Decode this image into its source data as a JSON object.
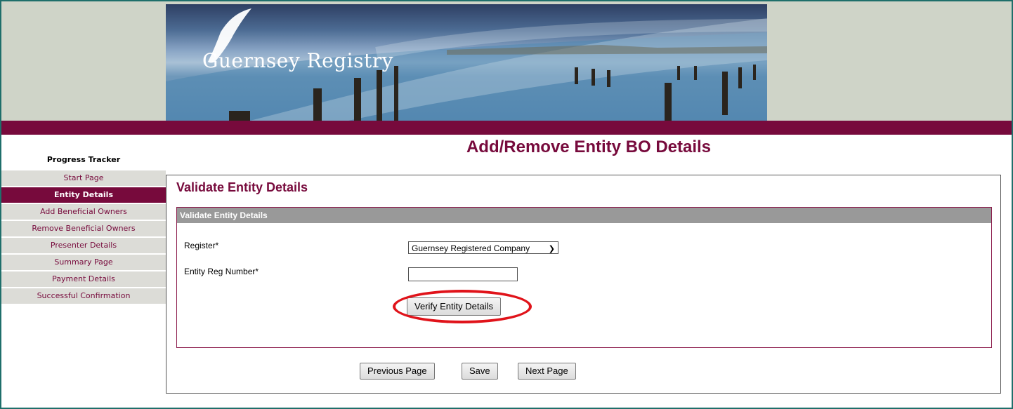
{
  "header": {
    "logo_text": "Guernsey Registry",
    "page_title": "Add/Remove Entity BO Details"
  },
  "tracker": {
    "title": "Progress Tracker",
    "items": [
      {
        "label": "Start Page",
        "active": false
      },
      {
        "label": "Entity Details",
        "active": true
      },
      {
        "label": "Add Beneficial Owners",
        "active": false
      },
      {
        "label": "Remove Beneficial Owners",
        "active": false
      },
      {
        "label": "Presenter Details",
        "active": false
      },
      {
        "label": "Summary Page",
        "active": false
      },
      {
        "label": "Payment Details",
        "active": false
      },
      {
        "label": "Successful Confirmation",
        "active": false
      }
    ]
  },
  "main": {
    "panel_title": "Validate Entity Details",
    "section_header": "Validate Entity Details",
    "register_label": "Register*",
    "register_value": "Guernsey Registered Company",
    "reg_number_label": "Entity Reg Number*",
    "reg_number_value": "",
    "verify_button": "Verify Entity Details"
  },
  "footer_buttons": {
    "previous": "Previous Page",
    "save": "Save",
    "next": "Next Page"
  },
  "colors": {
    "brand_maroon": "#770a3c",
    "frame_teal": "#1f6f6b",
    "header_sage": "#cfd4c8",
    "highlight_red": "#e0131a"
  }
}
